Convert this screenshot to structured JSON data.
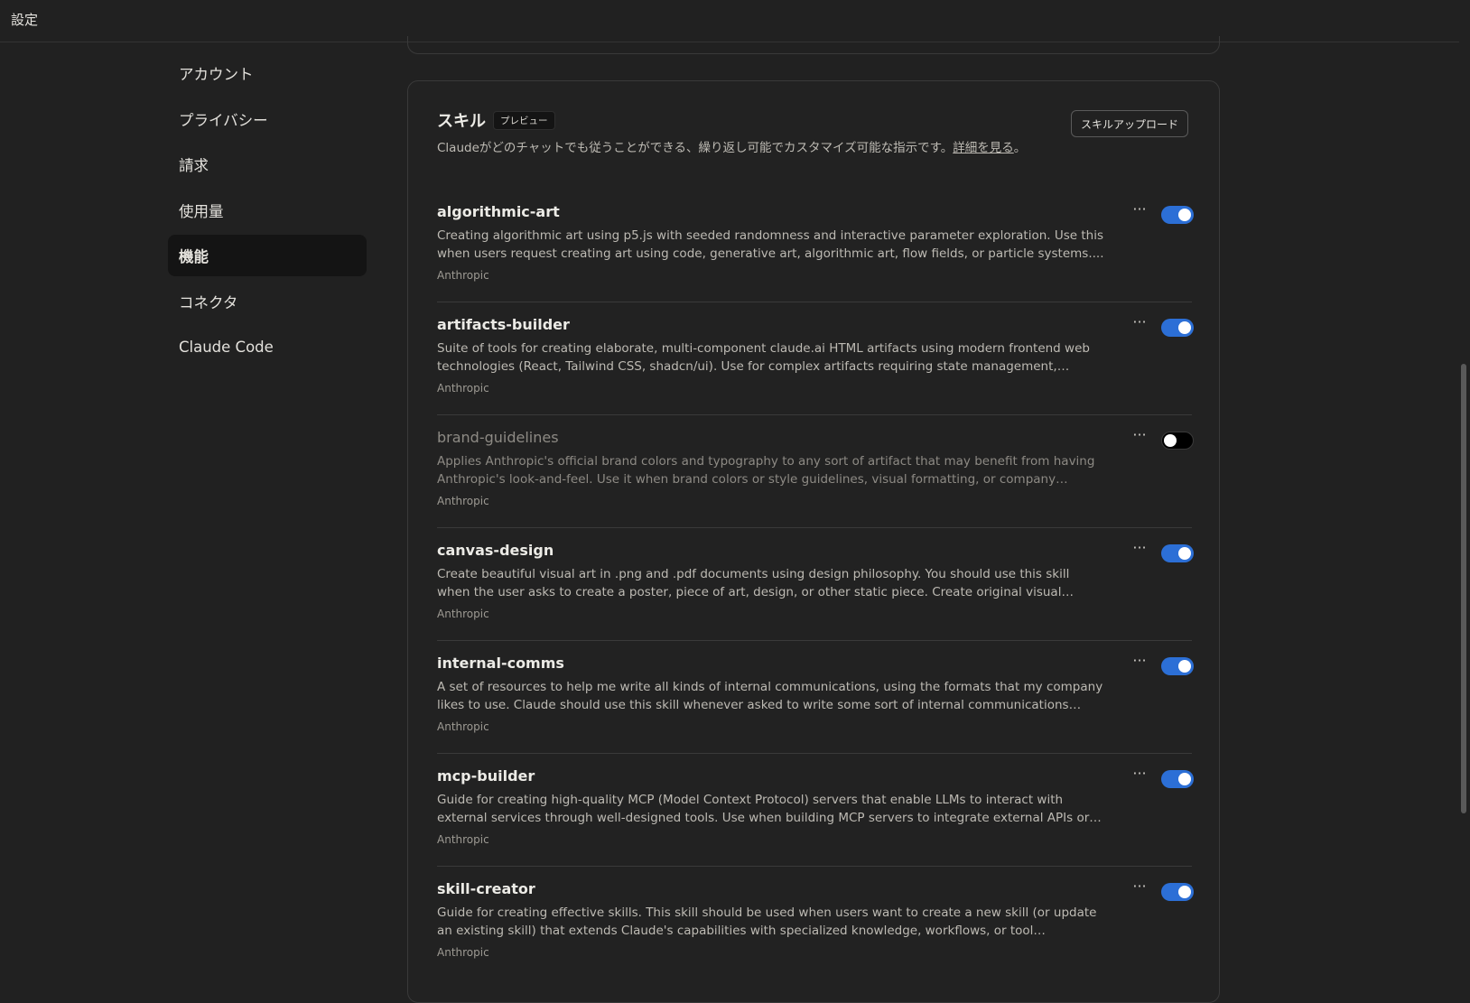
{
  "header": {
    "title": "設定"
  },
  "sidebar": {
    "items": [
      {
        "label": "アカウント",
        "active": false
      },
      {
        "label": "プライバシー",
        "active": false
      },
      {
        "label": "請求",
        "active": false
      },
      {
        "label": "使用量",
        "active": false
      },
      {
        "label": "機能",
        "active": true
      },
      {
        "label": "コネクタ",
        "active": false
      },
      {
        "label": "Claude Code",
        "active": false
      }
    ]
  },
  "skills_section": {
    "title": "スキル",
    "badge": "プレビュー",
    "description": "Claudeがどのチャットでも従うことができる、繰り返し可能でカスタマイズ可能な指示です。",
    "learn_more": "詳細を見る",
    "learn_more_suffix": "。",
    "upload_button": "スキルアップロード",
    "more_icon": "ellipsis-icon",
    "accent_color": "#2c6fd6",
    "skills": [
      {
        "name": "algorithmic-art",
        "description": "Creating algorithmic art using p5.js with seeded randomness and interactive parameter exploration. Use this when users request creating art using code, generative art, algorithmic art, flow fields, or particle systems....",
        "author": "Anthropic",
        "enabled": true
      },
      {
        "name": "artifacts-builder",
        "description": "Suite of tools for creating elaborate, multi-component claude.ai HTML artifacts using modern frontend web technologies (React, Tailwind CSS, shadcn/ui). Use for complex artifacts requiring state management, routing, ...",
        "author": "Anthropic",
        "enabled": true
      },
      {
        "name": "brand-guidelines",
        "description": "Applies Anthropic's official brand colors and typography to any sort of artifact that may benefit from having Anthropic's look-and-feel. Use it when brand colors or style guidelines, visual formatting, or company design...",
        "author": "Anthropic",
        "enabled": false
      },
      {
        "name": "canvas-design",
        "description": "Create beautiful visual art in .png and .pdf documents using design philosophy. You should use this skill when the user asks to create a poster, piece of art, design, or other static piece. Create original visual designs, never...",
        "author": "Anthropic",
        "enabled": true
      },
      {
        "name": "internal-comms",
        "description": "A set of resources to help me write all kinds of internal communications, using the formats that my company likes to use. Claude should use this skill whenever asked to write some sort of internal communications (status...",
        "author": "Anthropic",
        "enabled": true
      },
      {
        "name": "mcp-builder",
        "description": "Guide for creating high-quality MCP (Model Context Protocol) servers that enable LLMs to interact with external services through well-designed tools. Use when building MCP servers to integrate external APIs or services,...",
        "author": "Anthropic",
        "enabled": true
      },
      {
        "name": "skill-creator",
        "description": "Guide for creating effective skills. This skill should be used when users want to create a new skill (or update an existing skill) that extends Claude's capabilities with specialized knowledge, workflows, or tool integrations.",
        "author": "Anthropic",
        "enabled": true
      }
    ]
  }
}
